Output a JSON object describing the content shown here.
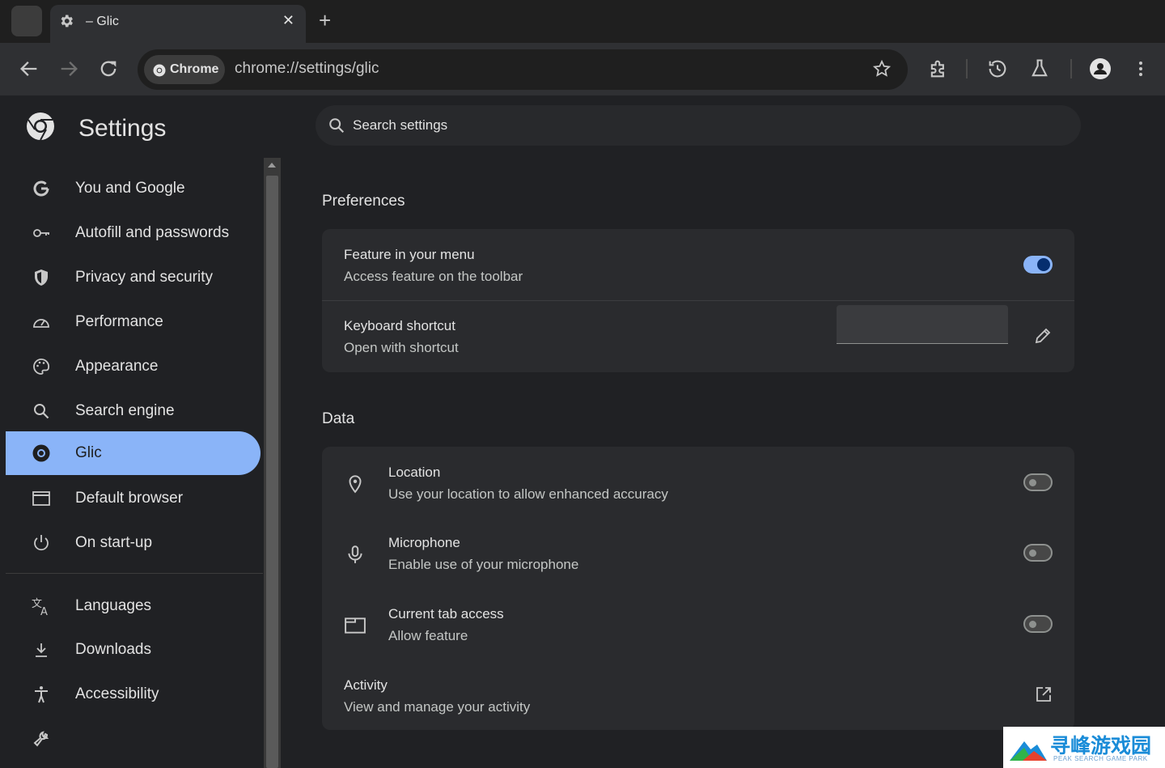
{
  "browser": {
    "tab_title": "– Glic",
    "tab_close": "✕",
    "new_tab": "+",
    "omnibox_chip": "Chrome",
    "url": "chrome://settings/glic"
  },
  "sidebar": {
    "title": "Settings",
    "items": [
      {
        "label": "You and Google",
        "icon": "google-g-icon"
      },
      {
        "label": "Autofill and passwords",
        "icon": "key-icon"
      },
      {
        "label": "Privacy and security",
        "icon": "shield-icon"
      },
      {
        "label": "Performance",
        "icon": "speedometer-icon"
      },
      {
        "label": "Appearance",
        "icon": "palette-icon"
      },
      {
        "label": "Search engine",
        "icon": "search-icon"
      },
      {
        "label": "Glic",
        "icon": "glic-icon",
        "active": true
      },
      {
        "label": "Default browser",
        "icon": "browser-window-icon"
      },
      {
        "label": "On start-up",
        "icon": "power-icon"
      },
      {
        "label": "Languages",
        "icon": "translate-icon"
      },
      {
        "label": "Downloads",
        "icon": "download-icon"
      },
      {
        "label": "Accessibility",
        "icon": "accessibility-icon"
      },
      {
        "label": "",
        "icon": "wrench-icon"
      }
    ]
  },
  "search": {
    "placeholder": "Search settings"
  },
  "preferences": {
    "title": "Preferences",
    "rows": [
      {
        "title": "Feature in your menu",
        "subtitle": "Access feature on the toolbar",
        "toggle": true
      },
      {
        "title": "Keyboard shortcut",
        "subtitle": "Open with shortcut",
        "shortcut_value": ""
      }
    ]
  },
  "data_section": {
    "title": "Data",
    "rows": [
      {
        "title": "Location",
        "subtitle": "Use your location to allow enhanced accuracy",
        "toggle": false,
        "icon": "location-pin-icon"
      },
      {
        "title": "Microphone",
        "subtitle": "Enable use of your microphone",
        "toggle": false,
        "icon": "microphone-icon"
      },
      {
        "title": "Current tab access",
        "subtitle": "Allow feature",
        "toggle": false,
        "icon": "tab-icon"
      },
      {
        "title": "Activity",
        "subtitle": "View and manage your activity",
        "icon": "open-in-new-icon"
      }
    ]
  },
  "watermark": {
    "text": "寻峰游戏园",
    "subtext": "PEAK SEARCH GAME PARK"
  },
  "colors": {
    "accent": "#8ab4f8",
    "background": "#202124",
    "card": "#2a2b2e"
  }
}
